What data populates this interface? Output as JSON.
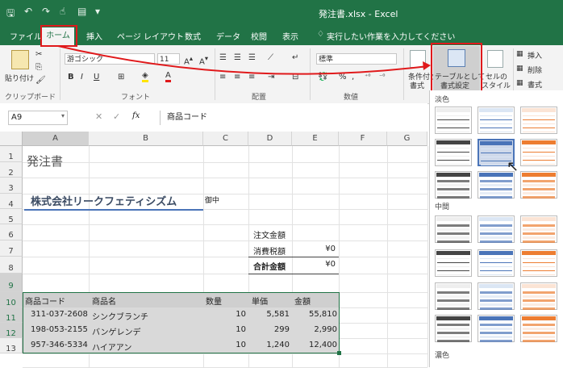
{
  "window": {
    "title": "発注書.xlsx  -  Excel"
  },
  "tabs": [
    "ファイル",
    "ホーム",
    "挿入",
    "ページ レイアウト",
    "数式",
    "データ",
    "校閲",
    "表示"
  ],
  "tell_me": "実行したい作業を入力してください",
  "ribbon": {
    "paste": "貼り付け",
    "clipboard": "クリップボード",
    "font_name": "游ゴシック",
    "font_size": "11",
    "font_group": "フォント",
    "alignment_group": "配置",
    "number_format": "標準",
    "number_group": "数値",
    "cond_format_l1": "条件付き",
    "cond_format_l2": "書式",
    "table_format_l1": "テーブルとして",
    "table_format_l2": "書式設定",
    "cell_style_l1": "セルの",
    "cell_style_l2": "スタイル",
    "insert": "挿入",
    "delete": "削除",
    "format": "書式"
  },
  "formula_bar": {
    "name_box": "A9",
    "fx": "fx",
    "content": "商品コード"
  },
  "gallery": {
    "light": "淡色",
    "medium": "中間",
    "dark": "濃色"
  },
  "columns": [
    "A",
    "B",
    "C",
    "D",
    "E",
    "F",
    "G"
  ],
  "rows": [
    "1",
    "2",
    "3",
    "4",
    "5",
    "6",
    "7",
    "8",
    "9",
    "10",
    "11",
    "12",
    "13"
  ],
  "sheet": {
    "title": "発注書",
    "company": "株式会社リークフェティシズム",
    "honorific": "御中",
    "order_total_label": "注文金額",
    "tax_label": "消費税額",
    "tax_value": "¥0",
    "total_label": "合計金額",
    "total_value": "¥0",
    "headers": [
      "商品コード",
      "商品名",
      "数量",
      "単価",
      "金額"
    ],
    "items": [
      [
        "311-037-2608",
        "シンクブランチ",
        "10",
        "5,581",
        "55,810"
      ],
      [
        "198-053-2155",
        "バンゲレンデ",
        "10",
        "299",
        "2,990"
      ],
      [
        "957-346-5334",
        "ハイアアン",
        "10",
        "1,240",
        "12,400"
      ]
    ]
  },
  "colors": {
    "excel_green": "#217346",
    "highlight_red": "#e0191b",
    "selection_gray": "#d9d9d9"
  }
}
